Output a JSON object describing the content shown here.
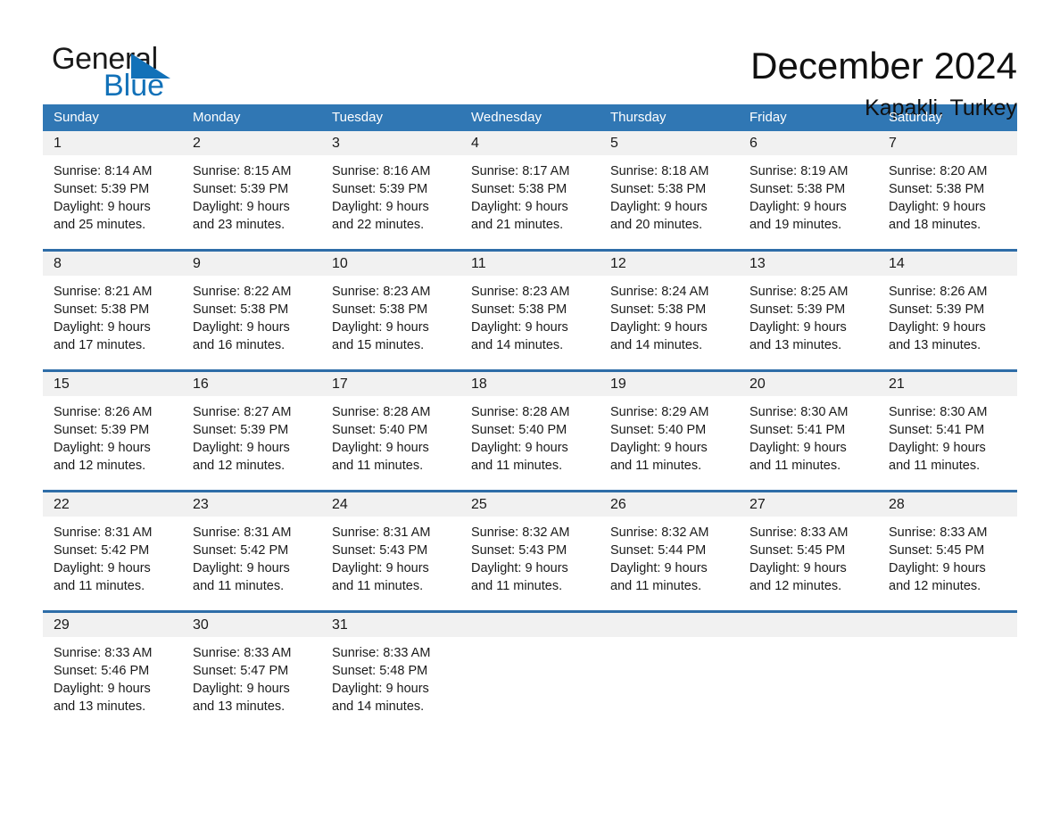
{
  "logo": {
    "word_one": "General",
    "word_two": "Blue",
    "triangle_color": "#1271b8",
    "text_color": "#1a1a1a"
  },
  "header": {
    "title": "December 2024",
    "subtitle": "Kapakli, Turkey"
  },
  "theme": {
    "header_row_bg": "#3077b4",
    "week_divider": "#2e6da8",
    "daynum_bg": "#f1f1f1",
    "text": "#1a1a1a"
  },
  "columns": [
    "Sunday",
    "Monday",
    "Tuesday",
    "Wednesday",
    "Thursday",
    "Friday",
    "Saturday"
  ],
  "weeks": [
    [
      {
        "day": "1",
        "sunrise": "Sunrise: 8:14 AM",
        "sunset": "Sunset: 5:39 PM",
        "daylight_1": "Daylight: 9 hours",
        "daylight_2": "and 25 minutes."
      },
      {
        "day": "2",
        "sunrise": "Sunrise: 8:15 AM",
        "sunset": "Sunset: 5:39 PM",
        "daylight_1": "Daylight: 9 hours",
        "daylight_2": "and 23 minutes."
      },
      {
        "day": "3",
        "sunrise": "Sunrise: 8:16 AM",
        "sunset": "Sunset: 5:39 PM",
        "daylight_1": "Daylight: 9 hours",
        "daylight_2": "and 22 minutes."
      },
      {
        "day": "4",
        "sunrise": "Sunrise: 8:17 AM",
        "sunset": "Sunset: 5:38 PM",
        "daylight_1": "Daylight: 9 hours",
        "daylight_2": "and 21 minutes."
      },
      {
        "day": "5",
        "sunrise": "Sunrise: 8:18 AM",
        "sunset": "Sunset: 5:38 PM",
        "daylight_1": "Daylight: 9 hours",
        "daylight_2": "and 20 minutes."
      },
      {
        "day": "6",
        "sunrise": "Sunrise: 8:19 AM",
        "sunset": "Sunset: 5:38 PM",
        "daylight_1": "Daylight: 9 hours",
        "daylight_2": "and 19 minutes."
      },
      {
        "day": "7",
        "sunrise": "Sunrise: 8:20 AM",
        "sunset": "Sunset: 5:38 PM",
        "daylight_1": "Daylight: 9 hours",
        "daylight_2": "and 18 minutes."
      }
    ],
    [
      {
        "day": "8",
        "sunrise": "Sunrise: 8:21 AM",
        "sunset": "Sunset: 5:38 PM",
        "daylight_1": "Daylight: 9 hours",
        "daylight_2": "and 17 minutes."
      },
      {
        "day": "9",
        "sunrise": "Sunrise: 8:22 AM",
        "sunset": "Sunset: 5:38 PM",
        "daylight_1": "Daylight: 9 hours",
        "daylight_2": "and 16 minutes."
      },
      {
        "day": "10",
        "sunrise": "Sunrise: 8:23 AM",
        "sunset": "Sunset: 5:38 PM",
        "daylight_1": "Daylight: 9 hours",
        "daylight_2": "and 15 minutes."
      },
      {
        "day": "11",
        "sunrise": "Sunrise: 8:23 AM",
        "sunset": "Sunset: 5:38 PM",
        "daylight_1": "Daylight: 9 hours",
        "daylight_2": "and 14 minutes."
      },
      {
        "day": "12",
        "sunrise": "Sunrise: 8:24 AM",
        "sunset": "Sunset: 5:38 PM",
        "daylight_1": "Daylight: 9 hours",
        "daylight_2": "and 14 minutes."
      },
      {
        "day": "13",
        "sunrise": "Sunrise: 8:25 AM",
        "sunset": "Sunset: 5:39 PM",
        "daylight_1": "Daylight: 9 hours",
        "daylight_2": "and 13 minutes."
      },
      {
        "day": "14",
        "sunrise": "Sunrise: 8:26 AM",
        "sunset": "Sunset: 5:39 PM",
        "daylight_1": "Daylight: 9 hours",
        "daylight_2": "and 13 minutes."
      }
    ],
    [
      {
        "day": "15",
        "sunrise": "Sunrise: 8:26 AM",
        "sunset": "Sunset: 5:39 PM",
        "daylight_1": "Daylight: 9 hours",
        "daylight_2": "and 12 minutes."
      },
      {
        "day": "16",
        "sunrise": "Sunrise: 8:27 AM",
        "sunset": "Sunset: 5:39 PM",
        "daylight_1": "Daylight: 9 hours",
        "daylight_2": "and 12 minutes."
      },
      {
        "day": "17",
        "sunrise": "Sunrise: 8:28 AM",
        "sunset": "Sunset: 5:40 PM",
        "daylight_1": "Daylight: 9 hours",
        "daylight_2": "and 11 minutes."
      },
      {
        "day": "18",
        "sunrise": "Sunrise: 8:28 AM",
        "sunset": "Sunset: 5:40 PM",
        "daylight_1": "Daylight: 9 hours",
        "daylight_2": "and 11 minutes."
      },
      {
        "day": "19",
        "sunrise": "Sunrise: 8:29 AM",
        "sunset": "Sunset: 5:40 PM",
        "daylight_1": "Daylight: 9 hours",
        "daylight_2": "and 11 minutes."
      },
      {
        "day": "20",
        "sunrise": "Sunrise: 8:30 AM",
        "sunset": "Sunset: 5:41 PM",
        "daylight_1": "Daylight: 9 hours",
        "daylight_2": "and 11 minutes."
      },
      {
        "day": "21",
        "sunrise": "Sunrise: 8:30 AM",
        "sunset": "Sunset: 5:41 PM",
        "daylight_1": "Daylight: 9 hours",
        "daylight_2": "and 11 minutes."
      }
    ],
    [
      {
        "day": "22",
        "sunrise": "Sunrise: 8:31 AM",
        "sunset": "Sunset: 5:42 PM",
        "daylight_1": "Daylight: 9 hours",
        "daylight_2": "and 11 minutes."
      },
      {
        "day": "23",
        "sunrise": "Sunrise: 8:31 AM",
        "sunset": "Sunset: 5:42 PM",
        "daylight_1": "Daylight: 9 hours",
        "daylight_2": "and 11 minutes."
      },
      {
        "day": "24",
        "sunrise": "Sunrise: 8:31 AM",
        "sunset": "Sunset: 5:43 PM",
        "daylight_1": "Daylight: 9 hours",
        "daylight_2": "and 11 minutes."
      },
      {
        "day": "25",
        "sunrise": "Sunrise: 8:32 AM",
        "sunset": "Sunset: 5:43 PM",
        "daylight_1": "Daylight: 9 hours",
        "daylight_2": "and 11 minutes."
      },
      {
        "day": "26",
        "sunrise": "Sunrise: 8:32 AM",
        "sunset": "Sunset: 5:44 PM",
        "daylight_1": "Daylight: 9 hours",
        "daylight_2": "and 11 minutes."
      },
      {
        "day": "27",
        "sunrise": "Sunrise: 8:33 AM",
        "sunset": "Sunset: 5:45 PM",
        "daylight_1": "Daylight: 9 hours",
        "daylight_2": "and 12 minutes."
      },
      {
        "day": "28",
        "sunrise": "Sunrise: 8:33 AM",
        "sunset": "Sunset: 5:45 PM",
        "daylight_1": "Daylight: 9 hours",
        "daylight_2": "and 12 minutes."
      }
    ],
    [
      {
        "day": "29",
        "sunrise": "Sunrise: 8:33 AM",
        "sunset": "Sunset: 5:46 PM",
        "daylight_1": "Daylight: 9 hours",
        "daylight_2": "and 13 minutes."
      },
      {
        "day": "30",
        "sunrise": "Sunrise: 8:33 AM",
        "sunset": "Sunset: 5:47 PM",
        "daylight_1": "Daylight: 9 hours",
        "daylight_2": "and 13 minutes."
      },
      {
        "day": "31",
        "sunrise": "Sunrise: 8:33 AM",
        "sunset": "Sunset: 5:48 PM",
        "daylight_1": "Daylight: 9 hours",
        "daylight_2": "and 14 minutes."
      },
      {
        "day": "",
        "sunrise": "",
        "sunset": "",
        "daylight_1": "",
        "daylight_2": ""
      },
      {
        "day": "",
        "sunrise": "",
        "sunset": "",
        "daylight_1": "",
        "daylight_2": ""
      },
      {
        "day": "",
        "sunrise": "",
        "sunset": "",
        "daylight_1": "",
        "daylight_2": ""
      },
      {
        "day": "",
        "sunrise": "",
        "sunset": "",
        "daylight_1": "",
        "daylight_2": ""
      }
    ]
  ]
}
